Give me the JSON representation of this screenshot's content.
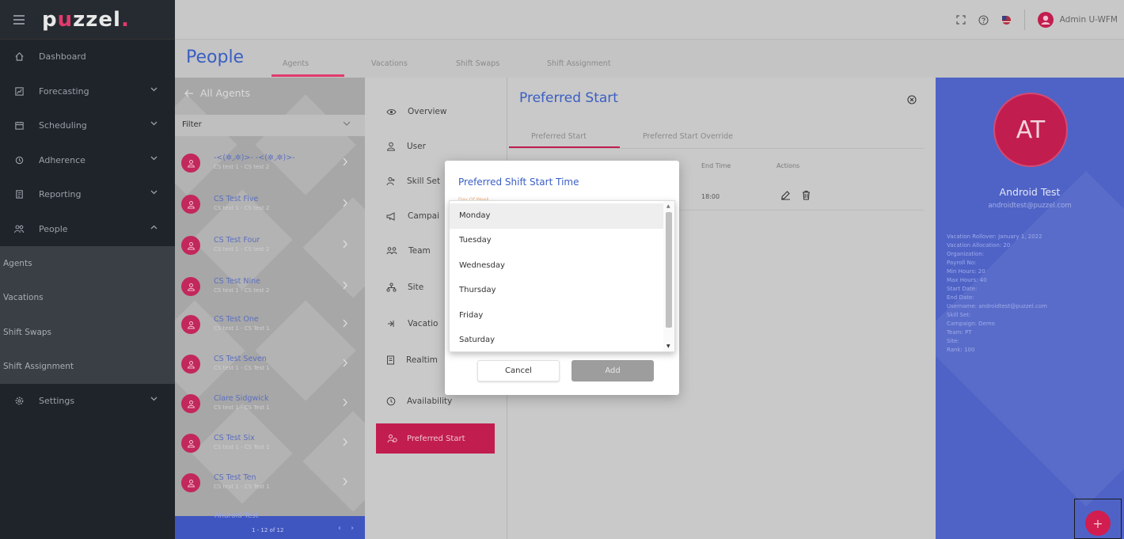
{
  "brand": {
    "logo_text_a": "p",
    "logo_text_dot": "u",
    "logo_text_b": "zzel",
    "logo_text_period": "."
  },
  "topbar": {
    "user_label": "Admin U-WFM"
  },
  "sidebar": {
    "items": [
      {
        "label": "Dashboard",
        "icon": "home-icon"
      },
      {
        "label": "Forecasting",
        "icon": "forecast-icon"
      },
      {
        "label": "Scheduling",
        "icon": "calendar-icon"
      },
      {
        "label": "Adherence",
        "icon": "adherence-icon"
      },
      {
        "label": "Reporting",
        "icon": "report-icon"
      },
      {
        "label": "People",
        "icon": "people-icon"
      }
    ],
    "sub_items": [
      "Agents",
      "Vacations",
      "Shift Swaps",
      "Shift Assignment"
    ],
    "settings_label": "Settings"
  },
  "header": {
    "title": "People",
    "tabs": [
      "Agents",
      "Vacations",
      "Shift Swaps",
      "Shift Assignment"
    ]
  },
  "agents": {
    "back_label": "All Agents",
    "filter_label": "Filter",
    "list": [
      {
        "name": "-<(✲◞✲)>- -<(✲◞✲)>-",
        "sub": "CS test 1 - CS test 2"
      },
      {
        "name": "CS Test Five",
        "sub": "CS test 1 - CS test 2"
      },
      {
        "name": "CS Test Four",
        "sub": "CS test 1 - CS test 2"
      },
      {
        "name": "CS Test Nine",
        "sub": "CS test 1 - CS test 2"
      },
      {
        "name": "CS Test One",
        "sub": "CS test 1 - CS Test 1"
      },
      {
        "name": "CS Test Seven",
        "sub": "CS test 1 - CS Test 1"
      },
      {
        "name": "Clare Sidgwick",
        "sub": "CS test 1 - CS Test 1"
      },
      {
        "name": "CS Test Six",
        "sub": "CS test 1 - CS Test 1"
      },
      {
        "name": "CS Test Ten",
        "sub": "CS test 1 - CS Test 1"
      }
    ],
    "cut_name": "Android Test",
    "pager_text": "1 - 12 of 12"
  },
  "detail_nav": {
    "items": [
      "Overview",
      "User",
      "Skill Set",
      "Campai",
      "Team",
      "Site",
      "Vacatio",
      "Realtim",
      "Availability"
    ],
    "active": "Preferred Start"
  },
  "content": {
    "title": "Preferred Start",
    "tabs": [
      "Preferred Start",
      "Preferred Start Override"
    ],
    "columns": {
      "end_time": "End Time",
      "actions": "Actions"
    },
    "row": {
      "end_time": "18:00"
    }
  },
  "modal": {
    "title": "Preferred Shift Start Time",
    "field_label": "Day Of Week",
    "options": [
      "Monday",
      "Tuesday",
      "Wednesday",
      "Thursday",
      "Friday",
      "Saturday"
    ],
    "selected": "Monday",
    "cancel_label": "Cancel",
    "add_label": "Add"
  },
  "profile": {
    "initials": "AT",
    "name": "Android Test",
    "email": "androidtest@puzzel.com",
    "info": [
      "Vacation Rollover:  January 1, 2022",
      "Vacation Allocation:  20",
      "Organization:",
      "Payroll No:",
      "Min Hours:  20",
      "Max Hours:  40",
      "Start Date:",
      "End Date:",
      "Username:  androidtest@puzzel.com",
      "Skill Set:",
      "Campaign:  Demo",
      "Team:  PT",
      "Site:",
      "Rank:  100"
    ]
  },
  "fab_label": "+",
  "colors": {
    "accent": "#c21d4f",
    "primary": "#3a5ec4",
    "sidebar": "#1f232a",
    "profile": "#4f63c6"
  }
}
